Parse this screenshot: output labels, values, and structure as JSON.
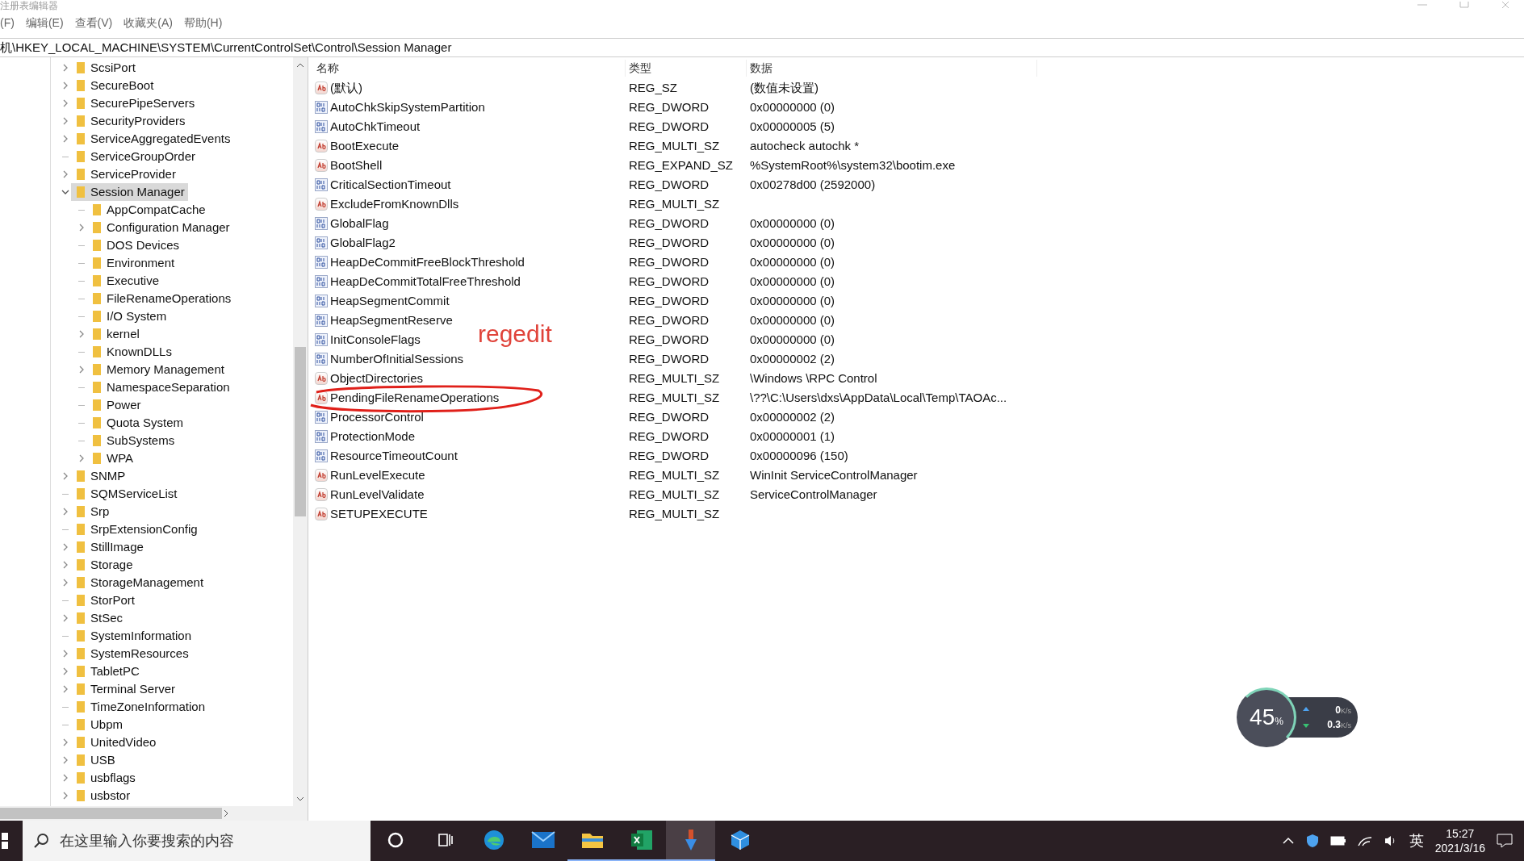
{
  "window": {
    "title": "注册表编辑器"
  },
  "menu": [
    "(F)",
    "编辑(E)",
    "查看(V)",
    "收藏夹(A)",
    "帮助(H)"
  ],
  "address": "机\\HKEY_LOCAL_MACHINE\\SYSTEM\\CurrentControlSet\\Control\\Session Manager",
  "tree": [
    {
      "label": "ScsiPort",
      "expandable": true,
      "expanded": false,
      "selected": false
    },
    {
      "label": "SecureBoot",
      "expandable": true,
      "expanded": false,
      "selected": false
    },
    {
      "label": "SecurePipeServers",
      "expandable": true,
      "expanded": false,
      "selected": false
    },
    {
      "label": "SecurityProviders",
      "expandable": true,
      "expanded": false,
      "selected": false
    },
    {
      "label": "ServiceAggregatedEvents",
      "expandable": true,
      "expanded": false,
      "selected": false
    },
    {
      "label": "ServiceGroupOrder",
      "expandable": false,
      "expanded": false,
      "selected": false
    },
    {
      "label": "ServiceProvider",
      "expandable": true,
      "expanded": false,
      "selected": false
    },
    {
      "label": "Session Manager",
      "expandable": true,
      "expanded": true,
      "selected": true,
      "children": [
        {
          "label": "AppCompatCache",
          "expandable": false,
          "expanded": false,
          "selected": false
        },
        {
          "label": "Configuration Manager",
          "expandable": true,
          "expanded": false,
          "selected": false
        },
        {
          "label": "DOS Devices",
          "expandable": false,
          "expanded": false,
          "selected": false
        },
        {
          "label": "Environment",
          "expandable": false,
          "expanded": false,
          "selected": false
        },
        {
          "label": "Executive",
          "expandable": false,
          "expanded": false,
          "selected": false
        },
        {
          "label": "FileRenameOperations",
          "expandable": false,
          "expanded": false,
          "selected": false
        },
        {
          "label": "I/O System",
          "expandable": false,
          "expanded": false,
          "selected": false
        },
        {
          "label": "kernel",
          "expandable": true,
          "expanded": false,
          "selected": false
        },
        {
          "label": "KnownDLLs",
          "expandable": false,
          "expanded": false,
          "selected": false
        },
        {
          "label": "Memory Management",
          "expandable": true,
          "expanded": false,
          "selected": false
        },
        {
          "label": "NamespaceSeparation",
          "expandable": false,
          "expanded": false,
          "selected": false
        },
        {
          "label": "Power",
          "expandable": false,
          "expanded": false,
          "selected": false
        },
        {
          "label": "Quota System",
          "expandable": false,
          "expanded": false,
          "selected": false
        },
        {
          "label": "SubSystems",
          "expandable": false,
          "expanded": false,
          "selected": false
        },
        {
          "label": "WPA",
          "expandable": true,
          "expanded": false,
          "selected": false
        }
      ]
    },
    {
      "label": "SNMP",
      "expandable": true,
      "expanded": false,
      "selected": false
    },
    {
      "label": "SQMServiceList",
      "expandable": false,
      "expanded": false,
      "selected": false
    },
    {
      "label": "Srp",
      "expandable": true,
      "expanded": false,
      "selected": false
    },
    {
      "label": "SrpExtensionConfig",
      "expandable": false,
      "expanded": false,
      "selected": false
    },
    {
      "label": "StillImage",
      "expandable": true,
      "expanded": false,
      "selected": false
    },
    {
      "label": "Storage",
      "expandable": true,
      "expanded": false,
      "selected": false
    },
    {
      "label": "StorageManagement",
      "expandable": true,
      "expanded": false,
      "selected": false
    },
    {
      "label": "StorPort",
      "expandable": false,
      "expanded": false,
      "selected": false
    },
    {
      "label": "StSec",
      "expandable": true,
      "expanded": false,
      "selected": false
    },
    {
      "label": "SystemInformation",
      "expandable": false,
      "expanded": false,
      "selected": false
    },
    {
      "label": "SystemResources",
      "expandable": true,
      "expanded": false,
      "selected": false
    },
    {
      "label": "TabletPC",
      "expandable": true,
      "expanded": false,
      "selected": false
    },
    {
      "label": "Terminal Server",
      "expandable": true,
      "expanded": false,
      "selected": false
    },
    {
      "label": "TimeZoneInformation",
      "expandable": false,
      "expanded": false,
      "selected": false
    },
    {
      "label": "Ubpm",
      "expandable": false,
      "expanded": false,
      "selected": false
    },
    {
      "label": "UnitedVideo",
      "expandable": true,
      "expanded": false,
      "selected": false
    },
    {
      "label": "USB",
      "expandable": true,
      "expanded": false,
      "selected": false
    },
    {
      "label": "usbflags",
      "expandable": true,
      "expanded": false,
      "selected": false
    },
    {
      "label": "usbstor",
      "expandable": true,
      "expanded": false,
      "selected": false
    }
  ],
  "table": {
    "columns": [
      "名称",
      "类型",
      "数据"
    ],
    "rows": [
      {
        "kind": "string",
        "name": "(默认)",
        "type": "REG_SZ",
        "data": "(数值未设置)"
      },
      {
        "kind": "binary",
        "name": "AutoChkSkipSystemPartition",
        "type": "REG_DWORD",
        "data": "0x00000000 (0)"
      },
      {
        "kind": "binary",
        "name": "AutoChkTimeout",
        "type": "REG_DWORD",
        "data": "0x00000005 (5)"
      },
      {
        "kind": "string",
        "name": "BootExecute",
        "type": "REG_MULTI_SZ",
        "data": "autocheck autochk *"
      },
      {
        "kind": "string",
        "name": "BootShell",
        "type": "REG_EXPAND_SZ",
        "data": "%SystemRoot%\\system32\\bootim.exe"
      },
      {
        "kind": "binary",
        "name": "CriticalSectionTimeout",
        "type": "REG_DWORD",
        "data": "0x00278d00 (2592000)"
      },
      {
        "kind": "string",
        "name": "ExcludeFromKnownDlls",
        "type": "REG_MULTI_SZ"
      },
      {
        "kind": "binary",
        "name": "GlobalFlag",
        "type": "REG_DWORD",
        "data": "0x00000000 (0)"
      },
      {
        "kind": "binary",
        "name": "GlobalFlag2",
        "type": "REG_DWORD",
        "data": "0x00000000 (0)"
      },
      {
        "kind": "binary",
        "name": "HeapDeCommitFreeBlockThreshold",
        "type": "REG_DWORD",
        "data": "0x00000000 (0)"
      },
      {
        "kind": "binary",
        "name": "HeapDeCommitTotalFreeThreshold",
        "type": "REG_DWORD",
        "data": "0x00000000 (0)"
      },
      {
        "kind": "binary",
        "name": "HeapSegmentCommit",
        "type": "REG_DWORD",
        "data": "0x00000000 (0)"
      },
      {
        "kind": "binary",
        "name": "HeapSegmentReserve",
        "type": "REG_DWORD",
        "data": "0x00000000 (0)"
      },
      {
        "kind": "binary",
        "name": "InitConsoleFlags",
        "type": "REG_DWORD",
        "data": "0x00000000 (0)"
      },
      {
        "kind": "binary",
        "name": "NumberOfInitialSessions",
        "type": "REG_DWORD",
        "data": "0x00000002 (2)"
      },
      {
        "kind": "string",
        "name": "ObjectDirectories",
        "type": "REG_MULTI_SZ",
        "data": "\\Windows \\RPC Control"
      },
      {
        "kind": "string",
        "name": "PendingFileRenameOperations",
        "type": "REG_MULTI_SZ",
        "data": "\\??\\C:\\Users\\dxs\\AppData\\Local\\Temp\\TAOAc..."
      },
      {
        "kind": "binary",
        "name": "ProcessorControl",
        "type": "REG_DWORD",
        "data": "0x00000002 (2)"
      },
      {
        "kind": "binary",
        "name": "ProtectionMode",
        "type": "REG_DWORD",
        "data": "0x00000001 (1)"
      },
      {
        "kind": "binary",
        "name": "ResourceTimeoutCount",
        "type": "REG_DWORD",
        "data": "0x00000096 (150)"
      },
      {
        "kind": "string",
        "name": "RunLevelExecute",
        "type": "REG_MULTI_SZ",
        "data": "WinInit ServiceControlManager"
      },
      {
        "kind": "string",
        "name": "RunLevelValidate",
        "type": "REG_MULTI_SZ",
        "data": "ServiceControlManager"
      },
      {
        "kind": "string",
        "name": "SETUPEXECUTE",
        "type": "REG_MULTI_SZ"
      }
    ]
  },
  "annotation": {
    "text": "regedit"
  },
  "monitor": {
    "percent": "45",
    "unit": "%",
    "upload": "0",
    "upload_unit": "K/s",
    "download": "0.3",
    "download_unit": "K/s"
  },
  "taskbar": {
    "search_placeholder": "在这里输入你要搜索的内容",
    "apps": [
      {
        "kind": "cortana",
        "selected": false
      },
      {
        "kind": "taskview",
        "selected": false
      },
      {
        "kind": "edge",
        "selected": false
      },
      {
        "kind": "mail",
        "selected": false
      },
      {
        "kind": "explorer",
        "selected": false
      },
      {
        "kind": "excel",
        "selected": false
      },
      {
        "kind": "regedit",
        "selected": true
      },
      {
        "kind": "app",
        "selected": false
      }
    ],
    "ime": "英",
    "time": "15:27",
    "date": "2021/3/16"
  }
}
